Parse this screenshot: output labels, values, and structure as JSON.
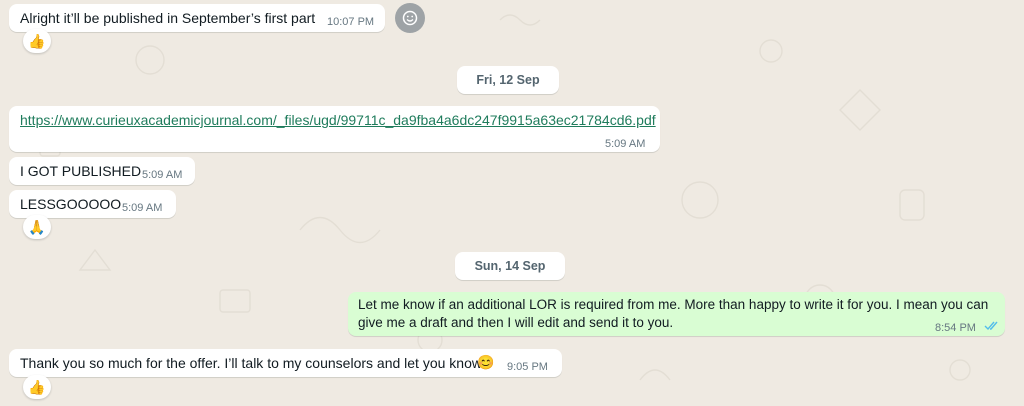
{
  "messages": [
    {
      "text": "Alright it’ll be published in September’s first part",
      "time": "10:07 PM",
      "reaction": "👍"
    },
    {
      "text": "https://www.curieuxacademicjournal.com/_files/ugd/99711c_da9fba4a6dc247f9915a63ec21784cd6.pdf",
      "time": "5:09 AM"
    },
    {
      "text": "I GOT PUBLISHED",
      "time": "5:09 AM"
    },
    {
      "text": "LESSGOOOOO",
      "time": "5:09 AM",
      "reaction": "🙏"
    },
    {
      "text": "Let me know if an additional LOR is required from me. More than happy to write it for you. I mean you can give me a draft and then I will edit and send it to you.",
      "time": "8:54 PM",
      "status": "read"
    },
    {
      "text": "Thank you so much for the offer. I’ll talk to my counselors and let you know",
      "emoji": "😊",
      "time": "9:05 PM",
      "reaction": "👍"
    }
  ],
  "dates": [
    "Fri, 12 Sep",
    "Sun, 14 Sep"
  ],
  "icons": {
    "react_button": "smiley-icon",
    "read_receipt": "double-check-icon"
  },
  "colors": {
    "incoming": "#ffffff",
    "outgoing": "#d9fdd3",
    "wallpaper": "#efeae2",
    "link": "#1f7c5c",
    "read_tick": "#53bdeb"
  }
}
